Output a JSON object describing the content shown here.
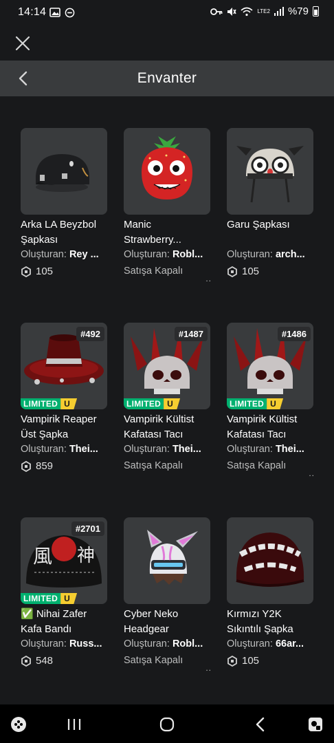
{
  "status": {
    "time": "14:14",
    "battery": "%79",
    "network": "LTE2"
  },
  "header": {
    "title": "Envanter"
  },
  "labels": {
    "creator_prefix": "Oluşturan:",
    "limited": "LIMITED",
    "unique": "U"
  },
  "items": [
    {
      "name": "Arka LA Beyzbol Şapkası",
      "creator": "Rey ...",
      "price": "105",
      "offsale": "",
      "serial": "",
      "limited": false,
      "icon": "black-baseball-cap"
    },
    {
      "name": "Manic Strawberry...",
      "creator": "Robl...",
      "price": "",
      "offsale": "Satışa Kapalı",
      "serial": "",
      "limited": false,
      "icon": "strawberry-head"
    },
    {
      "name": "Garu Şapkası",
      "creator": "arch...",
      "price": "105",
      "offsale": "",
      "serial": "",
      "limited": false,
      "icon": "garu-beanie"
    },
    {
      "name": "Vampirik Reaper Üst Şapka",
      "creator": "Thei...",
      "price": "859",
      "offsale": "",
      "serial": "#492",
      "limited": true,
      "icon": "red-top-hat"
    },
    {
      "name": "Vampirik Kültist Kafatası Tacı",
      "creator": "Thei...",
      "price": "",
      "offsale": "Satışa Kapalı",
      "serial": "#1487",
      "limited": true,
      "icon": "skull-crown"
    },
    {
      "name": "Vampirik Kültist Kafatası Tacı",
      "creator": "Thei...",
      "price": "",
      "offsale": "Satışa Kapalı",
      "serial": "#1486",
      "limited": true,
      "icon": "skull-crown"
    },
    {
      "name": "✅ Nihai Zafer Kafa Bandı",
      "creator": "Russ...",
      "price": "548",
      "offsale": "",
      "serial": "#2701",
      "limited": true,
      "icon": "victory-headband"
    },
    {
      "name": "Cyber Neko Headgear",
      "creator": "Robl...",
      "price": "",
      "offsale": "Satışa Kapalı",
      "serial": "",
      "limited": false,
      "icon": "cyber-neko-helmet"
    },
    {
      "name": "Kırmızı Y2K Sıkıntılı Şapka",
      "creator": "66ar...",
      "price": "105",
      "offsale": "",
      "serial": "",
      "limited": false,
      "icon": "red-y2k-beanie"
    }
  ]
}
